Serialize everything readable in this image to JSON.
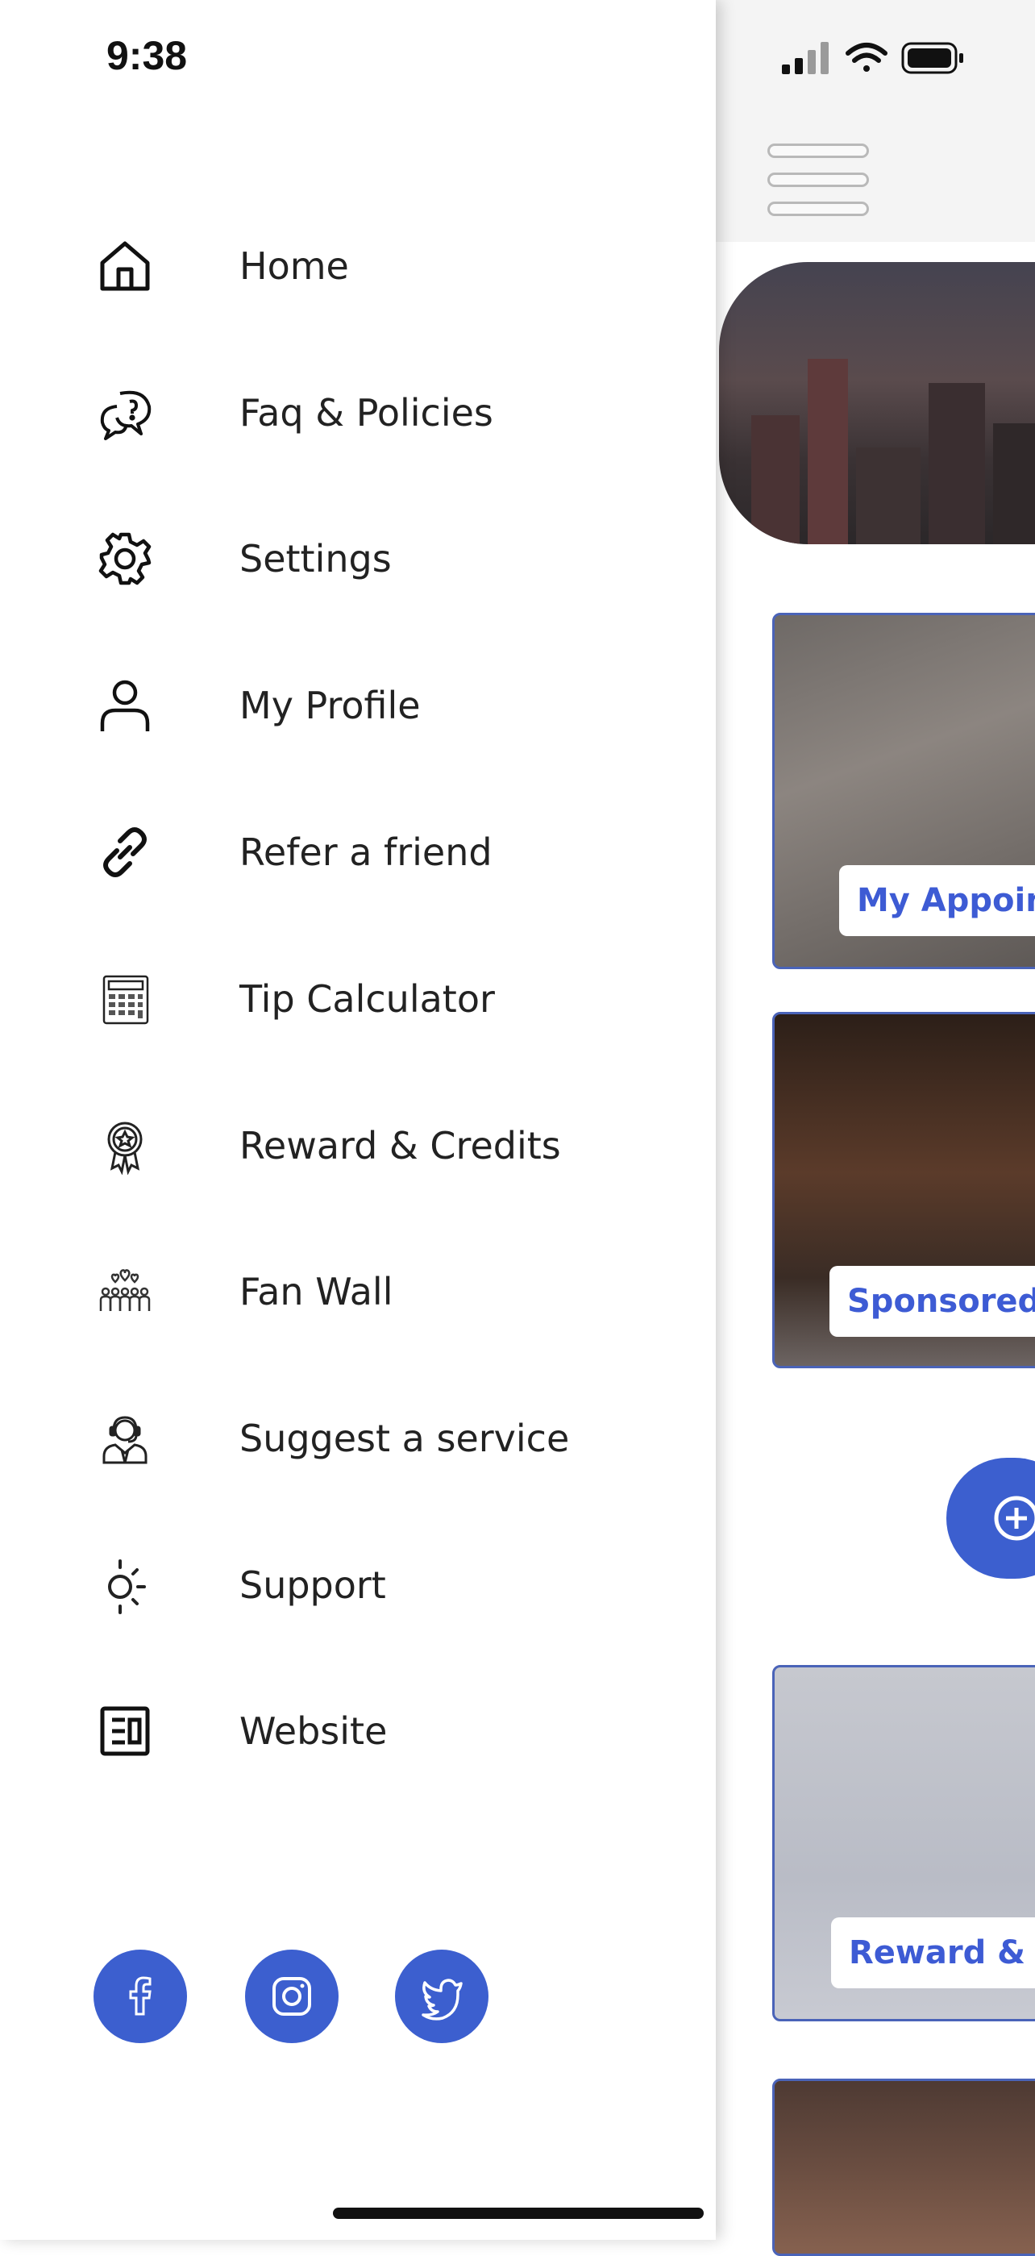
{
  "status_bar": {
    "time": "9:38"
  },
  "drawer": {
    "items": [
      {
        "label": "Home",
        "icon": "home-icon"
      },
      {
        "label": "Faq & Policies",
        "icon": "faq-chat-icon"
      },
      {
        "label": "Settings",
        "icon": "gear-icon"
      },
      {
        "label": "My Profile",
        "icon": "user-icon"
      },
      {
        "label": "Refer a friend",
        "icon": "link-icon"
      },
      {
        "label": "Tip Calculator",
        "icon": "calculator-icon"
      },
      {
        "label": "Reward & Credits",
        "icon": "award-ribbon-icon"
      },
      {
        "label": "Fan Wall",
        "icon": "crowd-hearts-icon"
      },
      {
        "label": "Suggest a service",
        "icon": "support-agent-icon"
      },
      {
        "label": "Support",
        "icon": "sun-icon"
      },
      {
        "label": "Website",
        "icon": "website-icon"
      }
    ],
    "socials": [
      "facebook-icon",
      "instagram-icon",
      "twitter-icon"
    ]
  },
  "app": {
    "cards": [
      {
        "label": "My Appoint"
      },
      {
        "label": "Sponsored Li"
      },
      {
        "label": "Reward & C"
      }
    ]
  },
  "colors": {
    "accent": "#3c5fcf",
    "card_border": "#4a63b8",
    "text": "#222222"
  }
}
